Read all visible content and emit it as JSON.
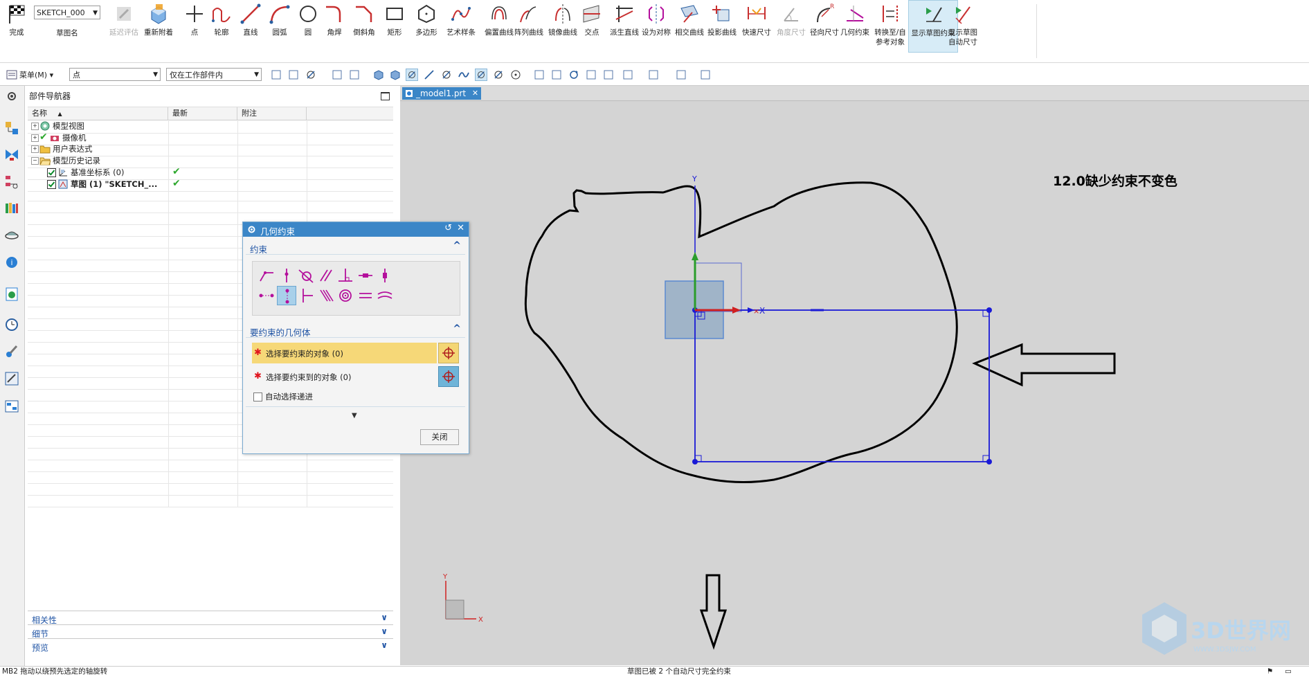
{
  "ribbon": {
    "finish": "完成",
    "sketch_name_value": "SKETCH_000",
    "sketch_name_label": "草图名",
    "items": [
      {
        "label": "延迟评估",
        "icon": "delay-eval-icon",
        "disabled": true
      },
      {
        "label": "重新附着",
        "icon": "reattach-icon"
      },
      {
        "label": "点",
        "icon": "point-icon"
      },
      {
        "label": "轮廓",
        "icon": "profile-icon"
      },
      {
        "label": "直线",
        "icon": "line-icon"
      },
      {
        "label": "圆弧",
        "icon": "arc-icon"
      },
      {
        "label": "圆",
        "icon": "circle-icon"
      },
      {
        "label": "角焊",
        "icon": "fillet-icon"
      },
      {
        "label": "倒斜角",
        "icon": "chamfer-icon"
      },
      {
        "label": "矩形",
        "icon": "rectangle-icon"
      },
      {
        "label": "多边形",
        "icon": "polygon-icon"
      },
      {
        "label": "艺术样条",
        "icon": "spline-icon"
      },
      {
        "label": "偏置曲线",
        "icon": "offset-curve-icon"
      },
      {
        "label": "阵列曲线",
        "icon": "pattern-curve-icon"
      },
      {
        "label": "镜像曲线",
        "icon": "mirror-curve-icon"
      },
      {
        "label": "交点",
        "icon": "intersection-point-icon"
      },
      {
        "label": "派生直线",
        "icon": "derived-line-icon"
      },
      {
        "label": "设为对称",
        "icon": "make-symmetric-icon"
      },
      {
        "label": "相交曲线",
        "icon": "intersection-curve-icon"
      },
      {
        "label": "投影曲线",
        "icon": "project-curve-icon"
      },
      {
        "label": "快速尺寸",
        "icon": "rapid-dimension-icon"
      },
      {
        "label": "角度尺寸",
        "icon": "angular-dimension-icon",
        "disabled": true
      },
      {
        "label": "径向尺寸",
        "icon": "radial-dimension-icon"
      },
      {
        "label": "几何约束",
        "icon": "geometric-constraint-icon"
      },
      {
        "label": "转换至/自",
        "label2": "参考对象",
        "icon": "convert-reference-icon"
      },
      {
        "label": "显示草图约束",
        "icon": "show-constraints-icon",
        "active": true
      },
      {
        "label": "显示草图",
        "label2": "自动尺寸",
        "icon": "show-auto-dimensions-icon"
      }
    ]
  },
  "toolbar2": {
    "menu_label": "菜单(M)",
    "filter_value": "点",
    "scope_value": "仅在工作部件内"
  },
  "navigator": {
    "title": "部件导航器",
    "columns": [
      "名称",
      "最新",
      "附注"
    ],
    "rows": [
      {
        "label": "模型视图",
        "expander": "+",
        "icon": "model-view-icon"
      },
      {
        "label": "摄像机",
        "expander": "+",
        "icon": "camera-icon",
        "check": true
      },
      {
        "label": "用户表达式",
        "expander": "+",
        "icon": "folder-icon"
      },
      {
        "label": "模型历史记录",
        "expander": "−",
        "icon": "folder-open-icon"
      },
      {
        "label": "基准坐标系 (0)",
        "icon": "datum-csys-icon",
        "checked": true,
        "latest": "✔"
      },
      {
        "label": "草图 (1) \"SKETCH_...",
        "icon": "sketch-icon",
        "checked": true,
        "latest": "✔",
        "bold": true
      }
    ],
    "panels": [
      "相关性",
      "细节",
      "预览"
    ]
  },
  "canvas": {
    "tab_label": "_model1.prt",
    "annotation": "12.0缺少约束不变色",
    "axis_x": "X",
    "axis_y": "Y",
    "triad_x": "X",
    "triad_y": "Y",
    "watermark_main": "3D世界网",
    "watermark_sub": "WWW.3DSJW.COM"
  },
  "dialog": {
    "title": "几何约束",
    "section_constraint": "约束",
    "section_geometry": "要约束的几何体",
    "select_object": "选择要约束的对象 (0)",
    "select_target": "选择要约束到的对象 (0)",
    "auto_select": "自动选择递进",
    "close": "关闭"
  },
  "status": {
    "left": "MB2 拖动以绕预先选定的轴旋转",
    "center": "草图已被 2 个自动尺寸完全约束"
  },
  "colors": {
    "accent": "#3b86c7",
    "sketch_blue": "#1a1ad6",
    "constraint_magenta": "#b4109c",
    "annotation_black": "#000000"
  }
}
